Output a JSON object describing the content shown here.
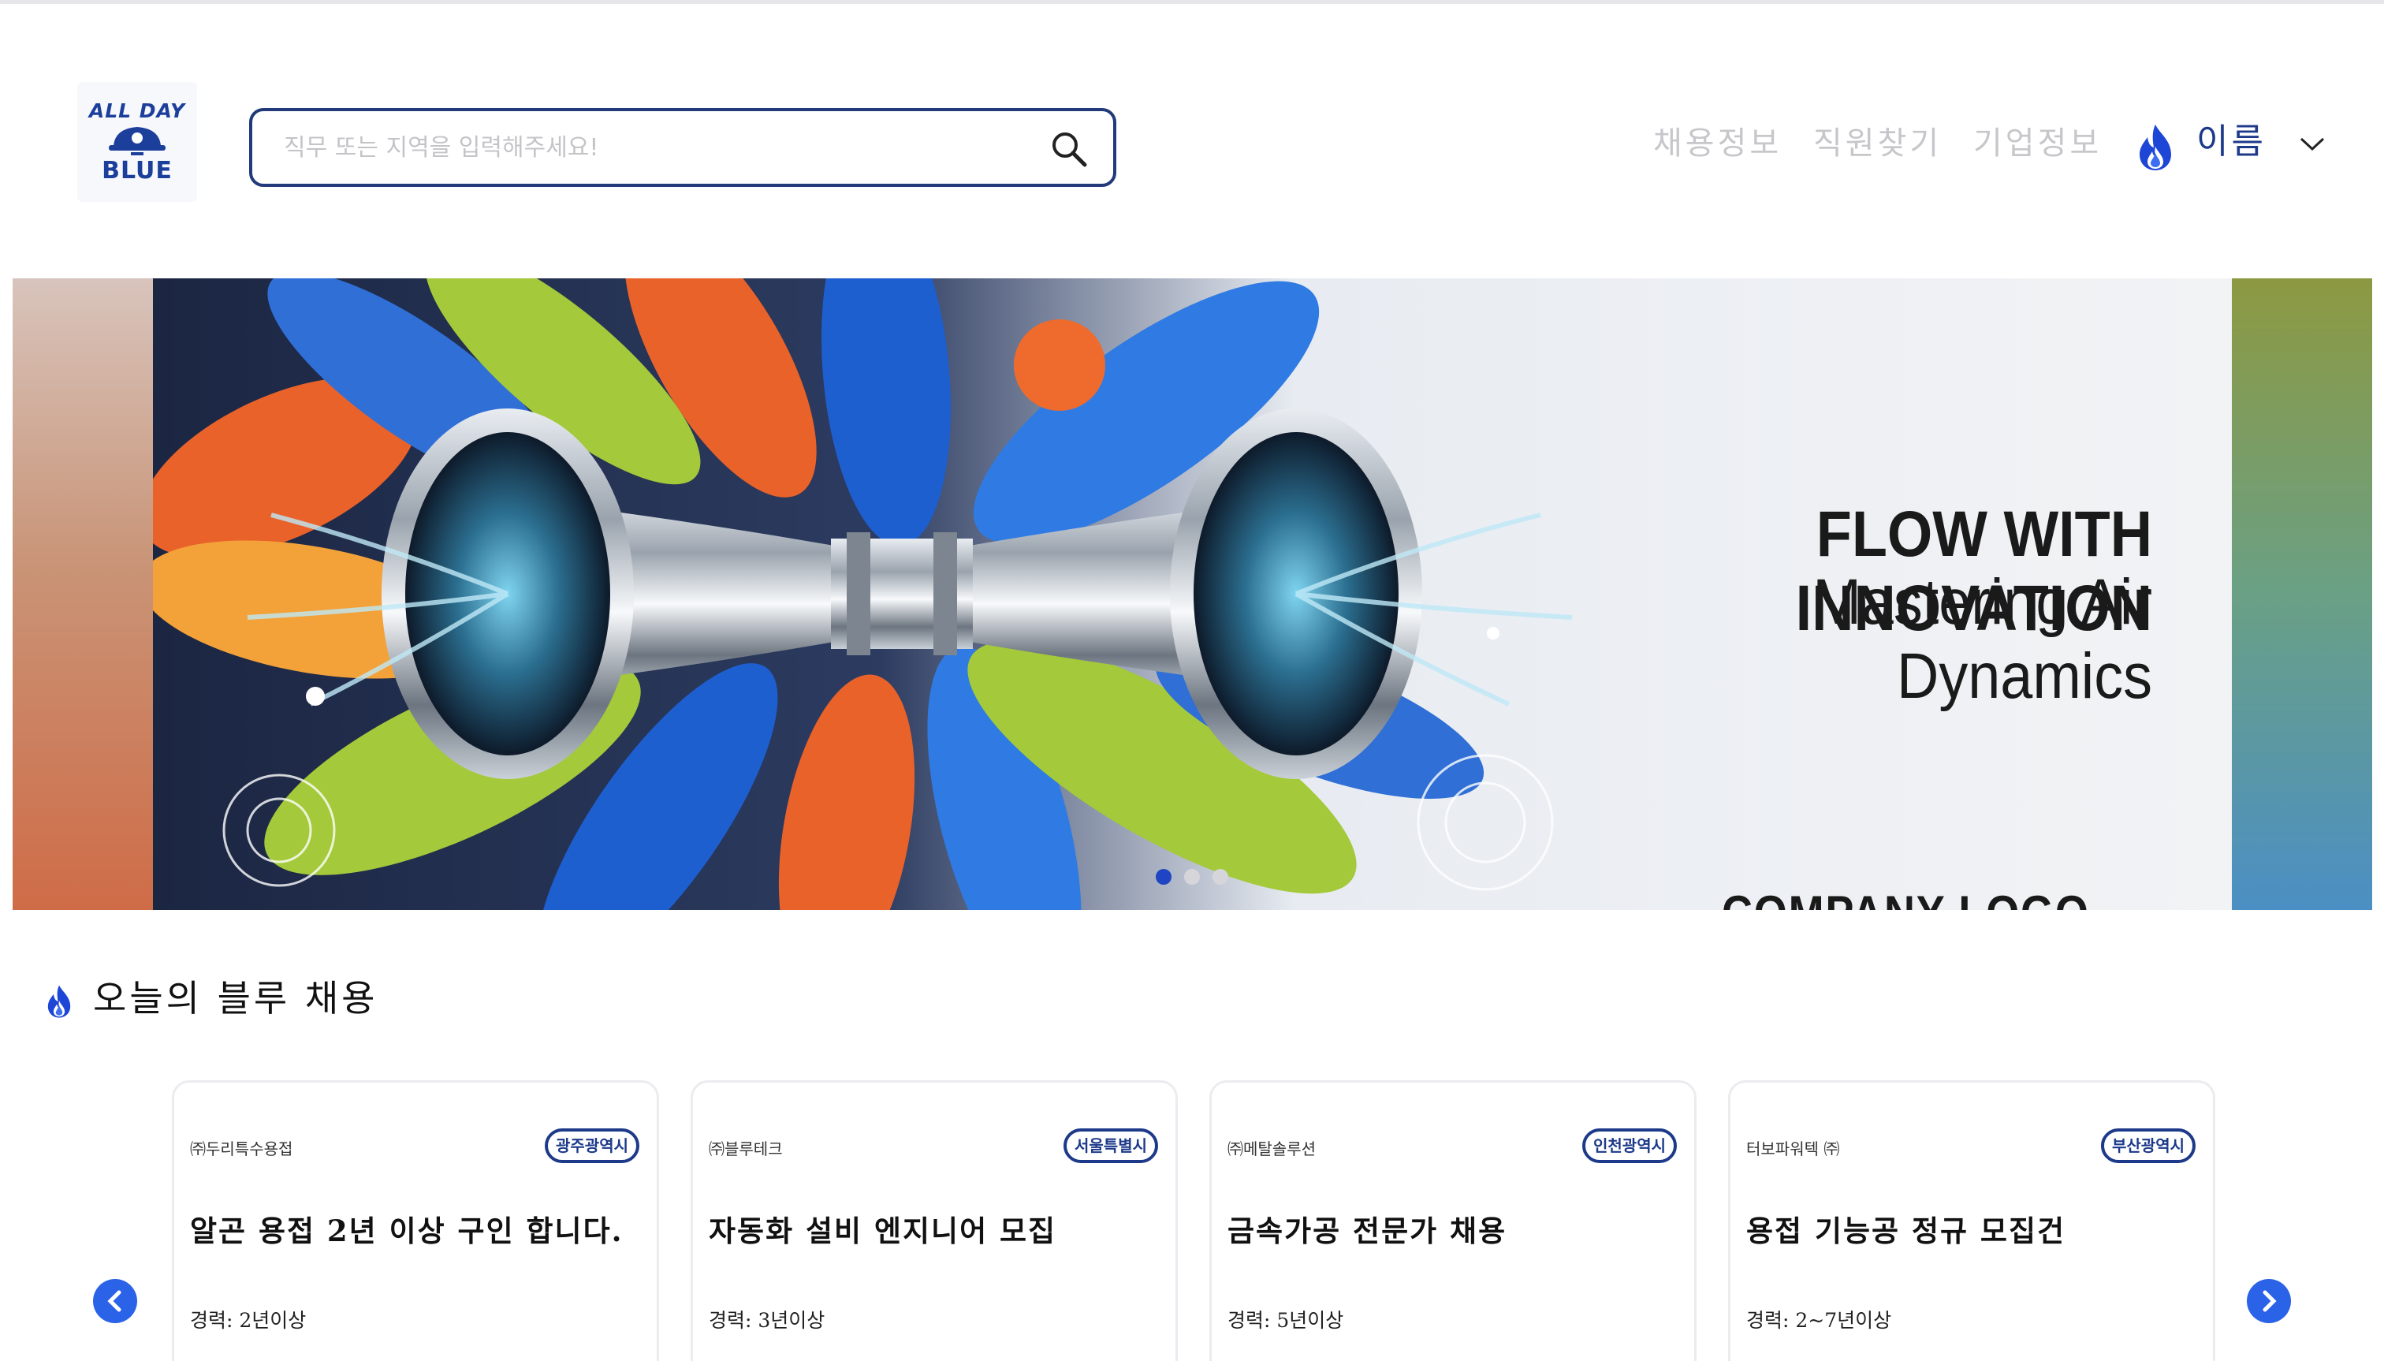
{
  "header": {
    "logo": {
      "line1": "ALL DAY",
      "line2": "BLUE"
    },
    "search": {
      "placeholder": "직무 또는 지역을 입력해주세요!"
    },
    "nav": [
      "채용정보",
      "직원찾기",
      "기업정보"
    ],
    "user": {
      "name": "이름",
      "icon": "flame-icon"
    }
  },
  "banner": {
    "headline": "FLOW WITH INNOVATION",
    "subheadline": "Mastering Air Dynamics",
    "company_logo_text": "COMPANY LOGO",
    "slides_total": 3,
    "active_slide": 1
  },
  "section": {
    "title": "오늘의 블루 채용",
    "cards": [
      {
        "company": "㈜두리특수용접",
        "region": "광주광역시",
        "title": "알곤 용접 2년 이상 구인 합니다.",
        "experience": "경력: 2년이상"
      },
      {
        "company": "㈜블루테크",
        "region": "서울특별시",
        "title": "자동화 설비 엔지니어 모집",
        "experience": "경력: 3년이상"
      },
      {
        "company": "㈜메탈솔루션",
        "region": "인천광역시",
        "title": "금속가공 전문가 채용",
        "experience": "경력: 5년이상"
      },
      {
        "company": "터보파워텍 ㈜",
        "region": "부산광역시",
        "title": "용접 기능공 정규 모집건",
        "experience": "경력: 2~7년이상"
      }
    ],
    "prev_icon": "chevron-left-icon",
    "next_icon": "chevron-right-icon"
  },
  "colors": {
    "brand": "#1d3a8a",
    "accent": "#2a62e8",
    "nav_inactive": "#c7c7cb"
  }
}
